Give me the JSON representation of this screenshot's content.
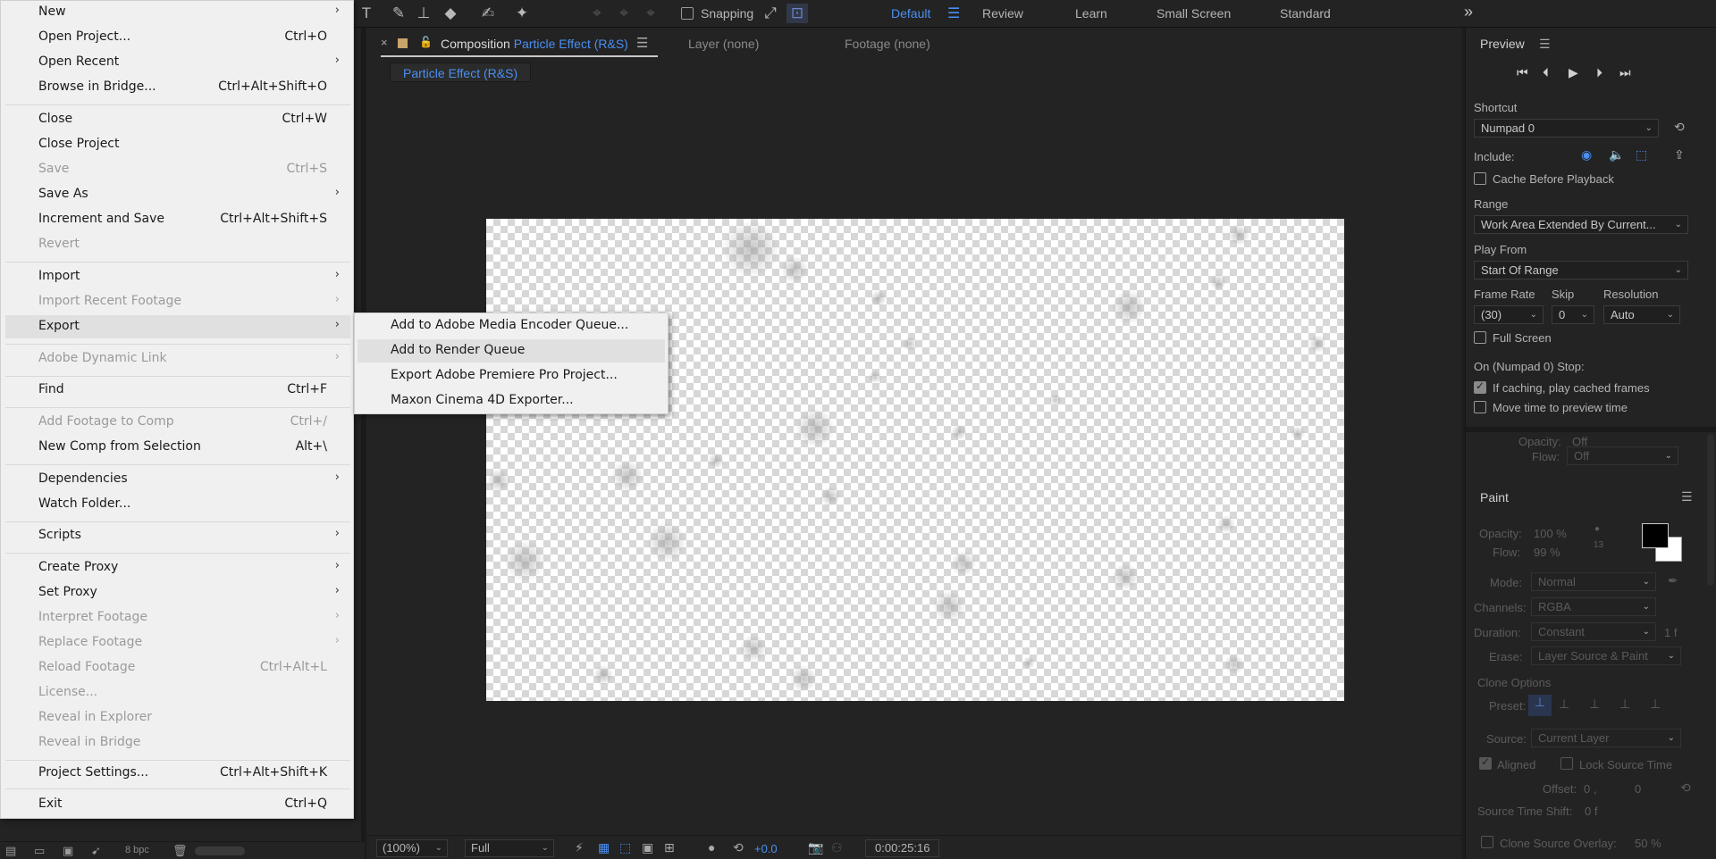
{
  "toolbar": {
    "snapping_label": "Snapping",
    "workspaces": [
      {
        "label": "Default",
        "active": true
      },
      {
        "label": "Review"
      },
      {
        "label": "Learn"
      },
      {
        "label": "Small Screen"
      },
      {
        "label": "Standard"
      }
    ],
    "more": "»"
  },
  "composition": {
    "tab_prefix": "Composition",
    "name": "Particle Effect (R&S)",
    "layer_tab": "Layer  (none)",
    "footage_tab": "Footage  (none)",
    "crumb": "Particle Effect (R&S)",
    "zoom": "(100%)",
    "resolution": "Full",
    "exposure": "+0.0",
    "time": "0:00:25:16"
  },
  "project_bar": {
    "bpc": "8 bpc"
  },
  "preview": {
    "title": "Preview",
    "shortcut_label": "Shortcut",
    "shortcut_value": "Numpad 0",
    "include_label": "Include:",
    "cache_label": "Cache Before Playback",
    "range_label": "Range",
    "range_value": "Work Area Extended By Current...",
    "playfrom_label": "Play From",
    "playfrom_value": "Start Of Range",
    "framerate_label": "Frame Rate",
    "framerate_value": "(30)",
    "skip_label": "Skip",
    "skip_value": "0",
    "resolution_label": "Resolution",
    "resolution_value": "Auto",
    "fullscreen_label": "Full Screen",
    "stop_label": "On (Numpad 0) Stop:",
    "caching_label": "If caching, play cached frames",
    "move_time_label": "Move time to preview time",
    "hidden_opacity": "Opacity:",
    "hidden_opacity_value": "Off",
    "hidden_flow": "Flow:",
    "hidden_flow_value": "Off"
  },
  "paint": {
    "title": "Paint",
    "opacity_label": "Opacity:",
    "opacity_value": "100 %",
    "flow_label": "Flow:",
    "flow_value": "99 %",
    "brush_size": "13",
    "mode_label": "Mode:",
    "mode_value": "Normal",
    "channels_label": "Channels:",
    "channels_value": "RGBA",
    "duration_label": "Duration:",
    "duration_value": "Constant",
    "duration_frames": "1 f",
    "erase_label": "Erase:",
    "erase_value": "Layer Source & Paint",
    "clone_options": "Clone Options",
    "preset_label": "Preset:",
    "source_label": "Source:",
    "source_value": "Current Layer",
    "aligned_label": "Aligned",
    "lock_source_label": "Lock Source Time",
    "offset_label": "Offset:",
    "offset_value_x": "0 ,",
    "offset_value_y": "0",
    "source_shift_label": "Source Time Shift:",
    "source_shift_value": "0  f",
    "clone_overlay_label": "Clone Source Overlay:",
    "clone_overlay_value": "50 %"
  },
  "file_menu": {
    "new": "New",
    "open_project": "Open Project...",
    "open_project_sc": "Ctrl+O",
    "open_recent": "Open Recent",
    "browse_bridge": "Browse in Bridge...",
    "browse_bridge_sc": "Ctrl+Alt+Shift+O",
    "close": "Close",
    "close_sc": "Ctrl+W",
    "close_project": "Close Project",
    "save": "Save",
    "save_sc": "Ctrl+S",
    "save_as": "Save As",
    "increment_save": "Increment and Save",
    "increment_save_sc": "Ctrl+Alt+Shift+S",
    "revert": "Revert",
    "import": "Import",
    "import_recent": "Import Recent Footage",
    "export": "Export",
    "dynamic_link": "Adobe Dynamic Link",
    "find": "Find",
    "find_sc": "Ctrl+F",
    "add_footage": "Add Footage to Comp",
    "add_footage_sc": "Ctrl+/",
    "new_comp_sel": "New Comp from Selection",
    "new_comp_sel_sc": "Alt+\\",
    "dependencies": "Dependencies",
    "watch_folder": "Watch Folder...",
    "scripts": "Scripts",
    "create_proxy": "Create Proxy",
    "set_proxy": "Set Proxy",
    "interpret_footage": "Interpret Footage",
    "replace_footage": "Replace Footage",
    "reload_footage": "Reload Footage",
    "reload_footage_sc": "Ctrl+Alt+L",
    "license": "License...",
    "reveal_explorer": "Reveal in Explorer",
    "reveal_bridge": "Reveal in Bridge",
    "project_settings": "Project Settings...",
    "project_settings_sc": "Ctrl+Alt+Shift+K",
    "exit": "Exit",
    "exit_sc": "Ctrl+Q"
  },
  "export_submenu": {
    "ame_queue": "Add to Adobe Media Encoder Queue...",
    "render_queue": "Add to Render Queue",
    "premiere": "Export Adobe Premiere Pro Project...",
    "c4d": "Maxon Cinema 4D Exporter..."
  }
}
